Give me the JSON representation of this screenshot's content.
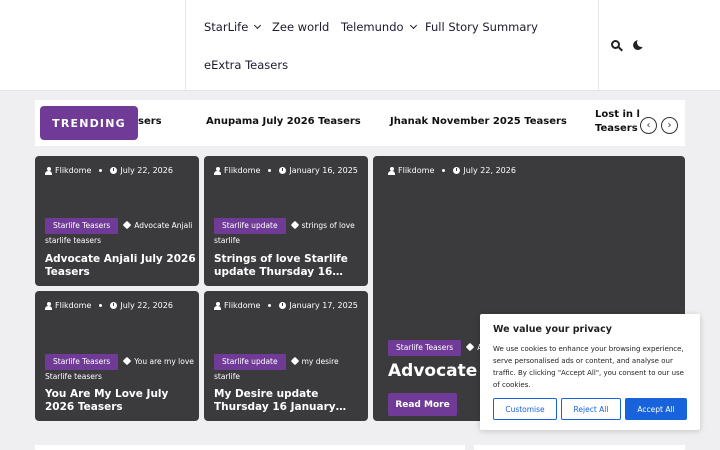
{
  "nav": {
    "items": [
      {
        "label": "StarLife",
        "dropdown": true
      },
      {
        "label": "Zee world",
        "dropdown": false
      },
      {
        "label": "Telemundo",
        "dropdown": true
      },
      {
        "label": "Full Story Summary",
        "dropdown": false
      },
      {
        "label": "eExtra Teasers",
        "dropdown": false
      }
    ],
    "icons": [
      "search-icon",
      "moon-icon"
    ]
  },
  "trending": {
    "label": "TRENDING",
    "items": [
      "sers",
      "Anupama July 2026 Teasers",
      "Jhanak November 2025 Teasers",
      "Lost in l",
      "Teasers"
    ],
    "prev_glyph": "‹",
    "next_glyph": "›"
  },
  "cards": [
    {
      "author": "Flikdome",
      "date": "July 22, 2026",
      "category": "Starlife Teasers",
      "tag_line1": "Advocate Anjali",
      "tag_line2": "starlife teasers",
      "title_line1": "Advocate Anjali July 2026",
      "title_line2": "Teasers"
    },
    {
      "author": "Flikdome",
      "date": "January 16, 2025",
      "category": "Starlife update",
      "tag_line1": "strings of love",
      "tag_line2": "starlife",
      "title_line1": "Strings of love Starlife",
      "title_line2": "update Thursday 16…"
    },
    {
      "author": "Flikdome",
      "date": "July 22, 2026",
      "category": "Starlife Teasers",
      "tag_line1": "You are my love",
      "tag_line2": "Starlife teasers",
      "title_line1": "You Are My Love July",
      "title_line2": "2026 Teasers"
    },
    {
      "author": "Flikdome",
      "date": "January 17, 2025",
      "category": "Starlife update",
      "tag_line1": "my desire",
      "tag_line2": "starlife",
      "title_line1": "My Desire update",
      "title_line2": "Thursday 16 January…"
    }
  ],
  "featured": {
    "author": "Flikdome",
    "date": "July 22, 2026",
    "category": "Starlife Teasers",
    "tag": "A",
    "title": "Advocate A",
    "read_more": "Read More"
  },
  "cookie": {
    "title": "We value your privacy",
    "body": "We use cookies to enhance your browsing experience, serve personalised ads or content, and analyse our traffic. By clicking \"Accept All\", you consent to our use of cookies.",
    "customise": "Customise",
    "reject": "Reject All",
    "accept": "Accept All"
  },
  "colors": {
    "accent": "#6f3b96",
    "card_bg": "#3b3b3d",
    "cookie_button": "#1863dc"
  }
}
